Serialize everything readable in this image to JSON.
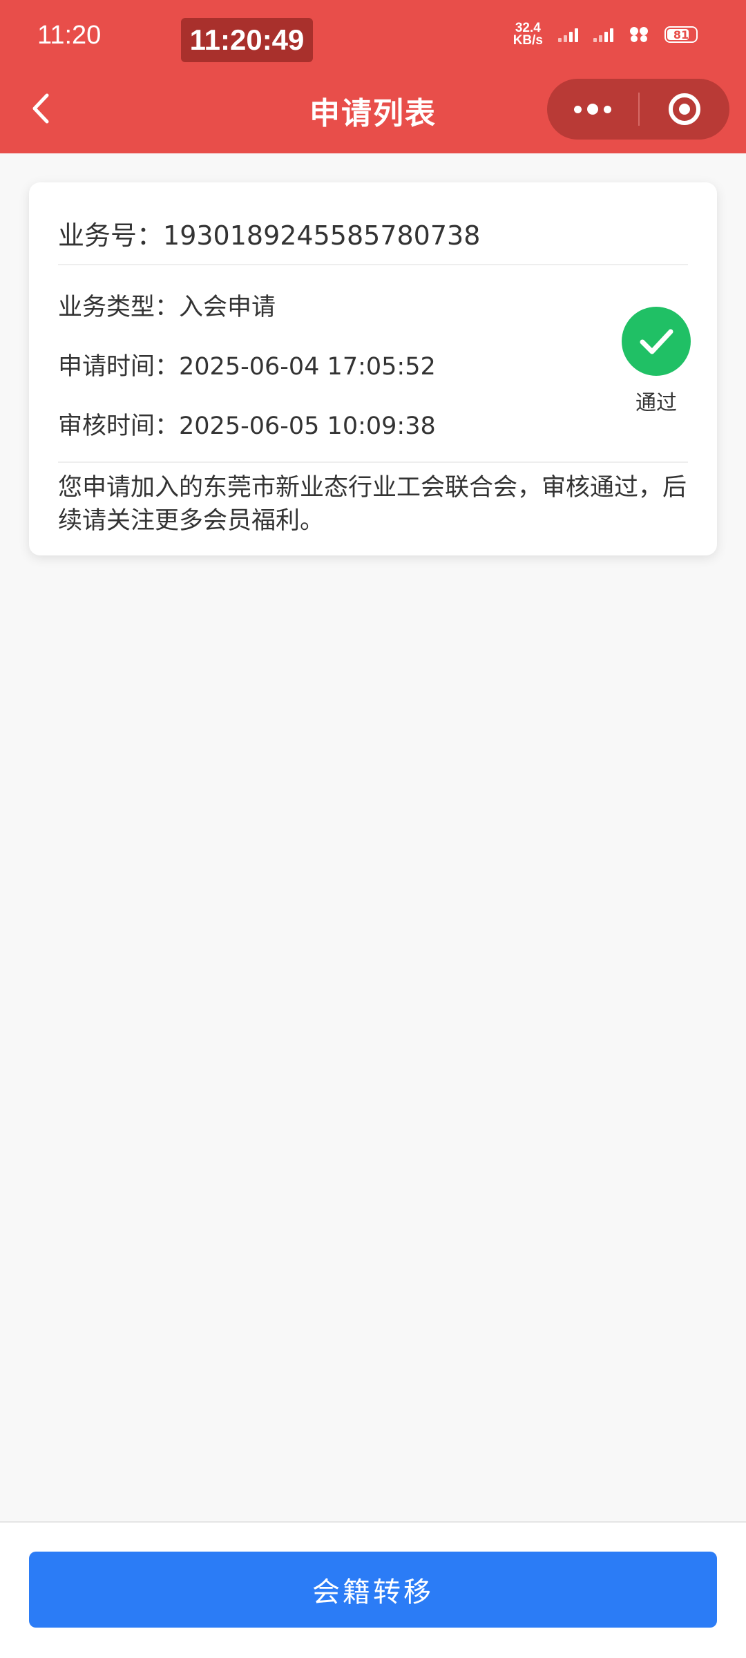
{
  "status_bar": {
    "time": "11:20",
    "clock": "11:20:49",
    "net_speed_value": "32.4",
    "net_speed_unit": "KB/s",
    "battery": "81"
  },
  "nav": {
    "title": "申请列表"
  },
  "card": {
    "business_no_label": "业务号：",
    "business_no": "1930189245585780738",
    "type_label": "业务类型：",
    "type": "入会申请",
    "apply_time_label": "申请时间：",
    "apply_time": "2025-06-04 17:05:52",
    "review_time_label": "审核时间：",
    "review_time": "2025-06-05 10:09:38",
    "status": "通过",
    "message": "您申请加入的东莞市新业态行业工会联合会，审核通过，后续请关注更多会员福利。"
  },
  "footer": {
    "button_label": "会籍转移"
  },
  "colors": {
    "header": "#e84e4a",
    "success": "#20c065",
    "primary": "#2b7cf6"
  }
}
